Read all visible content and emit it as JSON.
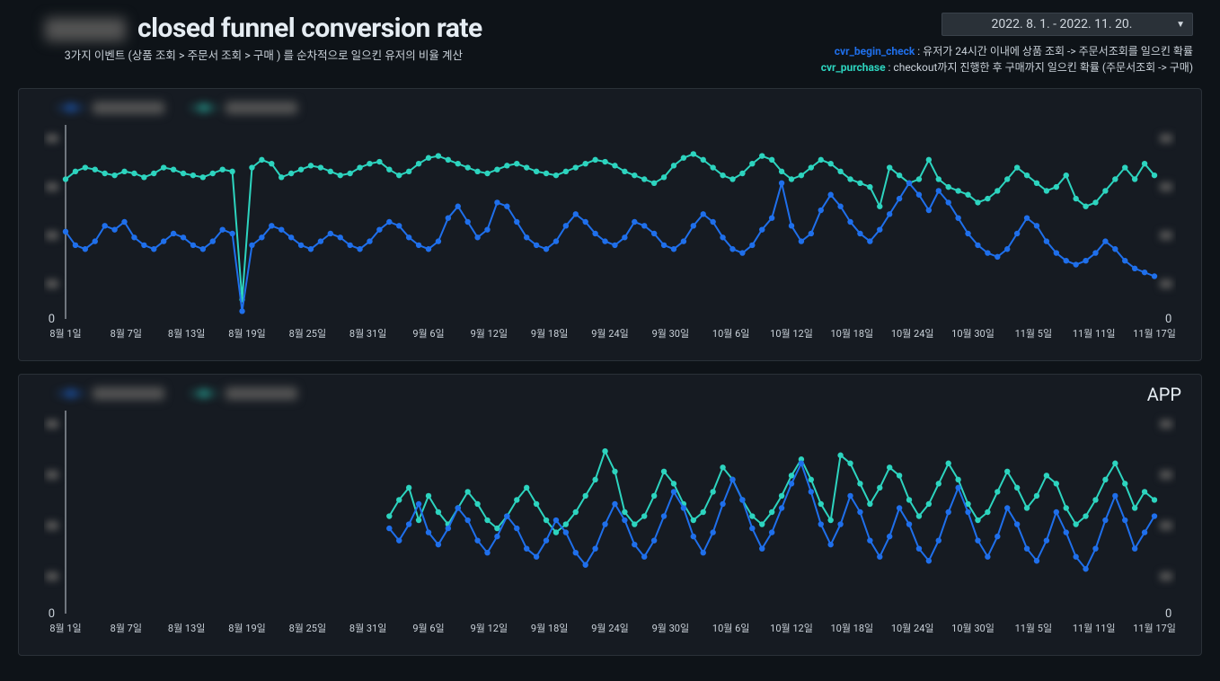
{
  "header": {
    "title_suffix": "closed funnel conversion rate",
    "subtitle": "3가지 이벤트 (상품 조회 > 주문서 조회 > 구매 ) 를 순차적으로 일으킨 유저의 비율 계산",
    "date_range": "2022. 8. 1. - 2022. 11. 20.",
    "desc1_key": "cvr_begin_check",
    "desc1_text": " : 유저가 24시간 이내에 상품 조회 -> 주문서조회를 일으킨 확률",
    "desc2_key": "cvr_purchase",
    "desc2_text": " : checkout까지 진행한 후 구매까지 일으킨 확률 (주문서조회 -> 구매)"
  },
  "panels": {
    "top_label": "",
    "bottom_label": "APP",
    "y_zero": "0"
  },
  "x_labels": [
    "8월 1일",
    "8월 7일",
    "8월 13일",
    "8월 19일",
    "8월 25일",
    "8월 31일",
    "9월 6일",
    "9월 12일",
    "9월 18일",
    "9월 24일",
    "9월 30일",
    "10월 6일",
    "10월 12일",
    "10월 18일",
    "10월 24일",
    "10월 30일",
    "11월 5일",
    "11월 11일",
    "11월 17일"
  ],
  "chart_data": [
    {
      "type": "line",
      "title": "closed funnel conversion rate (overall)",
      "xlabel": "",
      "ylabel": "",
      "ylim": [
        0,
        100
      ],
      "categories_ref": "x_labels",
      "series": [
        {
          "name": "cvr_begin_check",
          "color": "#2dd4bf",
          "values": [
            72,
            76,
            78,
            77,
            75,
            74,
            76,
            75,
            73,
            75,
            78,
            77,
            75,
            74,
            73,
            75,
            77,
            76,
            10,
            78,
            82,
            80,
            73,
            75,
            77,
            79,
            78,
            76,
            74,
            75,
            78,
            80,
            81,
            77,
            74,
            76,
            80,
            83,
            84,
            82,
            80,
            78,
            76,
            75,
            77,
            79,
            80,
            78,
            76,
            75,
            74,
            76,
            78,
            80,
            82,
            81,
            79,
            76,
            74,
            72,
            70,
            73,
            79,
            83,
            85,
            82,
            78,
            74,
            72,
            75,
            80,
            84,
            82,
            76,
            72,
            74,
            78,
            82,
            80,
            76,
            72,
            70,
            68,
            58,
            78,
            74,
            70,
            72,
            82,
            72,
            68,
            66,
            64,
            60,
            62,
            66,
            72,
            78,
            74,
            70,
            66,
            68,
            74,
            62,
            58,
            60,
            66,
            72,
            78,
            72,
            80,
            74
          ]
        },
        {
          "name": "cvr_purchase",
          "color": "#1f6feb",
          "values": [
            45,
            38,
            36,
            40,
            48,
            46,
            50,
            42,
            38,
            36,
            40,
            44,
            42,
            38,
            36,
            40,
            46,
            44,
            4,
            38,
            42,
            48,
            46,
            42,
            38,
            36,
            40,
            44,
            42,
            38,
            36,
            40,
            46,
            50,
            48,
            42,
            38,
            36,
            40,
            52,
            58,
            50,
            42,
            46,
            60,
            58,
            50,
            42,
            38,
            36,
            40,
            48,
            54,
            50,
            44,
            40,
            38,
            42,
            50,
            48,
            44,
            38,
            36,
            40,
            48,
            54,
            50,
            42,
            36,
            34,
            38,
            46,
            52,
            70,
            48,
            40,
            44,
            56,
            64,
            58,
            50,
            44,
            40,
            46,
            54,
            62,
            70,
            64,
            56,
            66,
            60,
            52,
            44,
            38,
            34,
            32,
            36,
            44,
            52,
            48,
            40,
            34,
            30,
            28,
            30,
            34,
            40,
            36,
            30,
            26,
            24,
            22
          ]
        }
      ]
    },
    {
      "type": "line",
      "title": "closed funnel conversion rate (APP)",
      "xlabel": "",
      "ylabel": "",
      "ylim": [
        0,
        100
      ],
      "categories_ref": "x_labels",
      "series": [
        {
          "name": "cvr_begin_check",
          "color": "#2dd4bf",
          "start_index": 33,
          "values": [
            48,
            56,
            62,
            46,
            58,
            50,
            44,
            52,
            60,
            54,
            46,
            42,
            48,
            56,
            62,
            54,
            46,
            40,
            44,
            50,
            58,
            66,
            80,
            70,
            50,
            44,
            48,
            58,
            70,
            64,
            54,
            46,
            50,
            60,
            72,
            66,
            56,
            48,
            44,
            50,
            58,
            68,
            76,
            66,
            54,
            46,
            78,
            74,
            64,
            54,
            62,
            72,
            68,
            56,
            48,
            54,
            64,
            74,
            66,
            54,
            46,
            50,
            60,
            70,
            62,
            52,
            58,
            68,
            64,
            52,
            44,
            48,
            56,
            66,
            74,
            64,
            52,
            60,
            56
          ]
        },
        {
          "name": "cvr_purchase",
          "color": "#1f6feb",
          "start_index": 33,
          "values": [
            42,
            36,
            44,
            54,
            40,
            34,
            42,
            52,
            46,
            36,
            30,
            38,
            48,
            42,
            32,
            28,
            36,
            46,
            40,
            30,
            24,
            32,
            44,
            54,
            46,
            34,
            28,
            36,
            48,
            60,
            52,
            38,
            30,
            40,
            54,
            66,
            56,
            42,
            32,
            40,
            52,
            64,
            74,
            60,
            44,
            34,
            44,
            58,
            50,
            36,
            28,
            38,
            52,
            44,
            32,
            26,
            36,
            50,
            62,
            50,
            36,
            28,
            38,
            52,
            44,
            32,
            26,
            36,
            50,
            40,
            28,
            22,
            32,
            46,
            58,
            46,
            32,
            40,
            48
          ]
        }
      ]
    }
  ]
}
